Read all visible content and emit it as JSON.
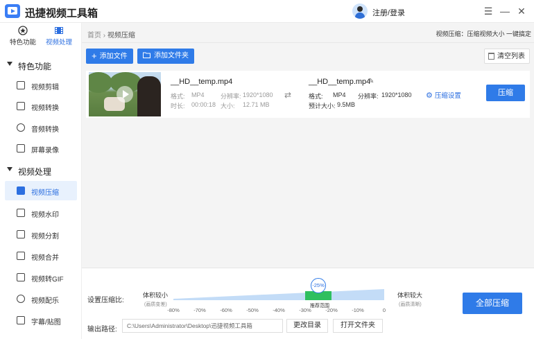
{
  "app": {
    "title": "迅捷视频工具箱",
    "login": "注册/登录"
  },
  "window": {
    "menu_glyph": "☰",
    "minimize_glyph": "—",
    "close_glyph": "✕"
  },
  "sidebar": {
    "tabs": [
      {
        "label": "特色功能",
        "icon": "star-icon"
      },
      {
        "label": "视频处理",
        "icon": "film-icon",
        "active": true
      }
    ],
    "sections": [
      {
        "label": "特色功能",
        "items": [
          "视频剪辑",
          "视频转换",
          "音频转换",
          "屏幕录像"
        ]
      },
      {
        "label": "视频处理",
        "items": [
          "视频压缩",
          "视频水印",
          "视频分割",
          "视频合并",
          "视频转GIF",
          "视频配乐",
          "字幕/贴图"
        ]
      }
    ],
    "active_item": "视频压缩"
  },
  "breadcrumb": {
    "home": "首页",
    "separator": "›",
    "current": "视频压缩",
    "hint": "视频压缩：压缩视频大小 一键搞定"
  },
  "toolbar": {
    "add_file": "添加文件",
    "add_folder": "添加文件夹",
    "clear_list": "清空列表"
  },
  "file": {
    "source": {
      "name": "__HD__temp.mp4",
      "format_label": "格式:",
      "format": "MP4",
      "resolution_label": "分辨率:",
      "resolution": "1920*1080",
      "duration_label": "时长:",
      "duration": "00:00:18",
      "size_label": "大小:",
      "size": "12.71 MB"
    },
    "output": {
      "name": "__HD__temp.mp4",
      "format_label": "格式:",
      "format": "MP4",
      "resolution_label": "分辨率:",
      "resolution": "1920*1080",
      "estimate_label": "预计大小:",
      "estimate": "9.5MB"
    },
    "settings_label": "压缩设置",
    "compress_label": "压缩"
  },
  "compression": {
    "label": "设置压缩比:",
    "smaller_label": "体积较小",
    "smaller_sub": "(画质变差)",
    "larger_label": "体积较大",
    "larger_sub": "(画质清晰)",
    "ticks": [
      "-80%",
      "-70%",
      "-60%",
      "-50%",
      "-40%",
      "-30%",
      "-20%",
      "-10%",
      "0"
    ],
    "value": "-25%",
    "value_percent": -25,
    "recommended_label": "推荐范围",
    "recommended_range": [
      -30,
      -20
    ],
    "compress_all": "全部压缩"
  },
  "output_path": {
    "label": "输出路径:",
    "value": "C:\\Users\\Administrator\\Desktop\\迅捷视频工具箱",
    "change_dir": "更改目录",
    "open_folder": "打开文件夹"
  },
  "colors": {
    "accent": "#2f7be8",
    "recommended": "#2fbf5f",
    "track": "#c3dcf7"
  }
}
